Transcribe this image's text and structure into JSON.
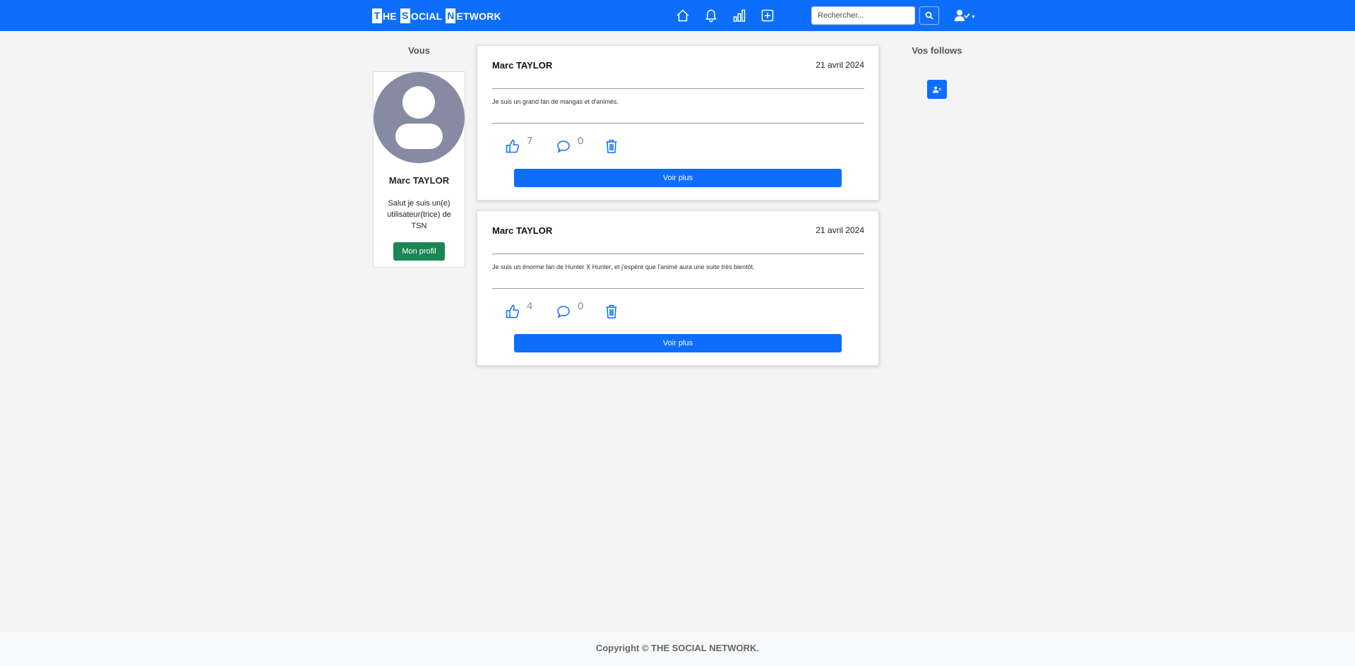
{
  "nav": {
    "brand": [
      {
        "cap": "T",
        "rest": "HE"
      },
      {
        "cap": "S",
        "rest": "OCIAL"
      },
      {
        "cap": "N",
        "rest": "ETWORK"
      }
    ],
    "search_placeholder": "Rechercher..."
  },
  "left": {
    "title": "Vous",
    "name": "Marc TAYLOR",
    "bio": "Salut je suis un(e) utilisateur(trice) de TSN",
    "profile_button": "Mon profil"
  },
  "posts": [
    {
      "author": "Marc TAYLOR",
      "date": "21 avril 2024",
      "content": "Je suis un grand fan de mangas et d'animés.",
      "likes": "7",
      "comments": "0",
      "button": "Voir plus"
    },
    {
      "author": "Marc TAYLOR",
      "date": "21 avril 2024",
      "content": "Je suis un énorme fan de Hunter X Hunter, et j'espère que l'animé aura une suite très bientôt.",
      "likes": "4",
      "comments": "0",
      "button": "Voir plus"
    }
  ],
  "right": {
    "title": "Vos follows"
  },
  "footer": {
    "text": "Copyright © THE SOCIAL NETWORK."
  },
  "colors": {
    "primary": "#0d6efd",
    "success": "#198754",
    "background": "#f4f4f4"
  }
}
